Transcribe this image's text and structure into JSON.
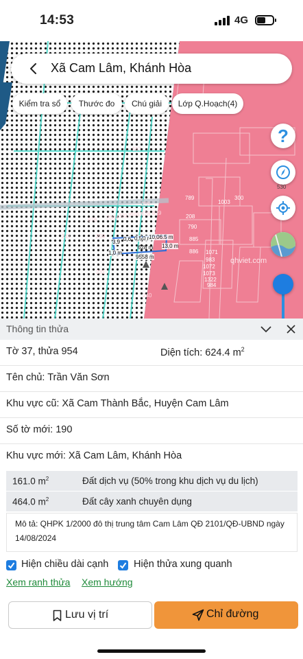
{
  "status_bar": {
    "time": "14:53",
    "network": "4G"
  },
  "search": {
    "title": "Xã Cam Lâm, Khánh Hòa"
  },
  "chips": [
    {
      "label": "Kiểm tra sổ"
    },
    {
      "label": "Thước đo"
    },
    {
      "label": "Chú giải"
    },
    {
      "label": "Lớp Q.Hoạch(4)"
    }
  ],
  "map": {
    "help_symbol": "?",
    "compass_value": "530",
    "watermark": "qhviet.com",
    "lot_labels": [
      "557",
      "205",
      "259",
      "241",
      "231",
      "240",
      "789",
      "1003",
      "300",
      "208",
      "790",
      "885",
      "886",
      "1071",
      "983",
      "1072",
      "1073",
      "1322",
      "984"
    ],
    "parcel_labels": [
      "3,9",
      "0,6",
      "0,5",
      "0 m",
      "10,06.5 m",
      "628 m",
      "13,0 m",
      "9558 m",
      "1,0 m",
      "676",
      "2004",
      "3317",
      "6667",
      "628",
      "829"
    ],
    "colors": {
      "residential": "#ef7f94",
      "green_dots": "#1c1c1c",
      "water": "#1f5a86",
      "accent": "#1e7de0"
    }
  },
  "sheet": {
    "title": "Thông tin thửa",
    "sheet_info": "Tờ 37, thửa 954",
    "area_label": "Diện tích: 624.4 m",
    "area_sup": "2",
    "owner": "Tên chủ: Trần Văn Sơn",
    "old_area": "Khu vực cũ: Xã Cam Thành Bắc, Huyện Cam Lâm",
    "new_sheet": "Số tờ mới: 190",
    "new_area": "Khu vực mới: Xã Cam Lâm, Khánh Hòa",
    "land_use": [
      {
        "area": "161.0 m",
        "sup": "2",
        "type": "Đất dịch vụ (50% trong khu dịch vụ du lịch)"
      },
      {
        "area": "464.0 m",
        "sup": "2",
        "type": "Đất cây xanh chuyên dụng"
      }
    ],
    "description": "Mô tả: QHPK 1/2000 đô thị trung tâm Cam Lâm QĐ 2101/QĐ-UBND ngày 14/08/2024",
    "checkboxes": [
      {
        "label": "Hiện chiều dài cạnh",
        "checked": true
      },
      {
        "label": "Hiện thửa xung quanh",
        "checked": true
      }
    ],
    "links": [
      "Xem ranh thửa",
      "Xem hướng"
    ],
    "buttons": {
      "save": "Lưu vị trí",
      "route": "Chỉ đường"
    }
  }
}
